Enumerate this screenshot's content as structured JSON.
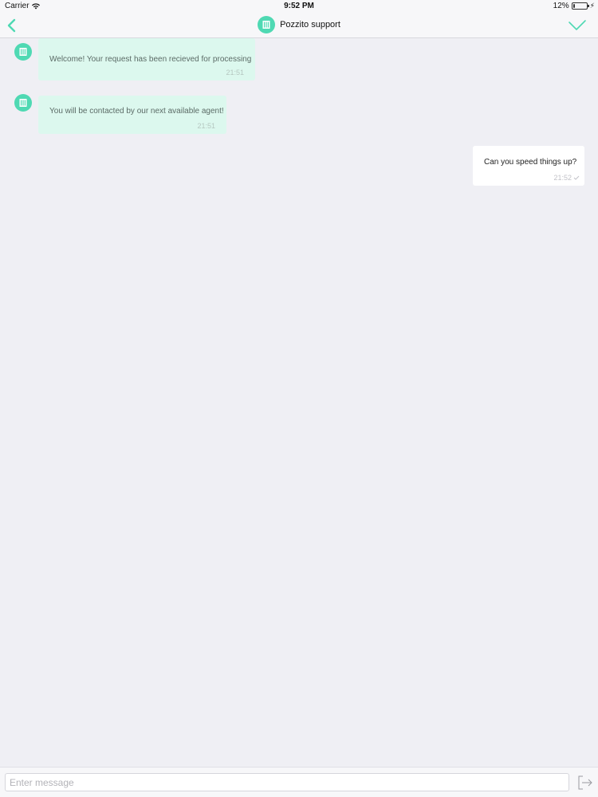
{
  "status_bar": {
    "carrier": "Carrier",
    "time": "9:52 PM",
    "battery_percent": "12%",
    "battery_level": 0.12
  },
  "nav": {
    "title": "Pozzito support",
    "back_icon": "chevron-left-icon",
    "done_icon": "checkmark-icon",
    "accent_color": "#4fd9b3"
  },
  "messages": [
    {
      "direction": "incoming",
      "text": "Welcome! Your request has been recieved for processing",
      "time": "21:51"
    },
    {
      "direction": "incoming",
      "text": "You will be contacted by our next available agent!",
      "time": "21:51"
    },
    {
      "direction": "outgoing",
      "text": "Can you speed things up?",
      "time": "21:52",
      "status_icon": "sent-check-icon"
    }
  ],
  "composer": {
    "placeholder": "Enter message",
    "value": "",
    "send_icon": "send-icon"
  }
}
